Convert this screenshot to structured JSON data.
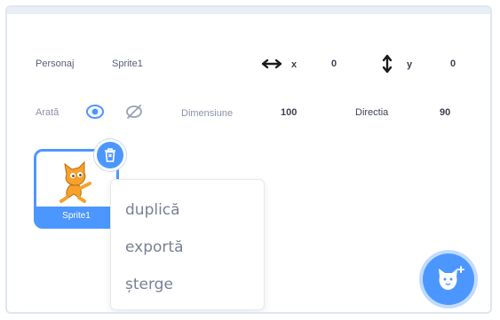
{
  "info": {
    "sprite_label": "Personaj",
    "sprite_value": "Sprite1",
    "x_label": "x",
    "x_value": "0",
    "y_label": "y",
    "y_value": "0",
    "show_label": "Arată",
    "size_label": "Dimensiune",
    "size_value": "100",
    "direction_label": "Directia",
    "direction_value": "90"
  },
  "sprite": {
    "name": "Sprite1"
  },
  "context_menu": {
    "items": [
      "duplică",
      "exportă",
      "șterge"
    ]
  },
  "icons": {
    "x_arrow": "horizontal-arrows-icon",
    "y_arrow": "vertical-arrows-icon",
    "show_visible": "eye-icon",
    "show_hidden": "eye-slash-icon",
    "delete": "trash-icon",
    "choose_sprite": "cat-add-icon"
  },
  "colors": {
    "accent": "#4c97ff",
    "text": "#575e75"
  }
}
